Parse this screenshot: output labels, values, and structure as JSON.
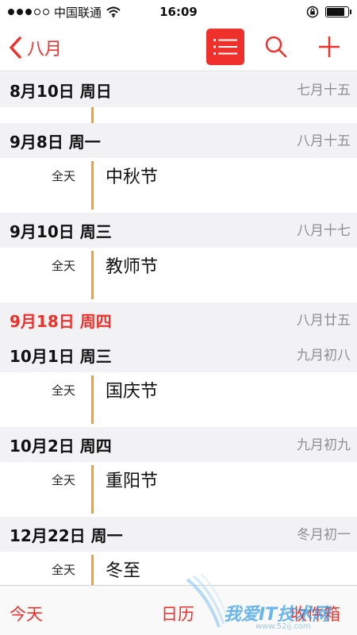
{
  "status_bar": {
    "carrier": "中国联通",
    "time": "16:09",
    "signal_bars_filled": 3,
    "signal_bars_total": 5,
    "battery_level": 0.85
  },
  "nav": {
    "back_label": "八月",
    "icons": [
      "chevron-left-icon",
      "list-icon",
      "search-icon",
      "plus-icon"
    ]
  },
  "days": [
    {
      "date": "8月10日  周日",
      "lunar": "七月十五",
      "is_today": false,
      "events": [
        {
          "when": "",
          "title": ""
        }
      ]
    },
    {
      "date": "9月8日  周一",
      "lunar": "八月十五",
      "is_today": false,
      "events": [
        {
          "when": "全天",
          "title": "中秋节"
        }
      ]
    },
    {
      "date": "9月10日  周三",
      "lunar": "八月十七",
      "is_today": false,
      "events": [
        {
          "when": "全天",
          "title": "教师节"
        }
      ]
    },
    {
      "date": "9月18日  周四",
      "lunar": "八月廿五",
      "is_today": true,
      "events": []
    },
    {
      "date": "10月1日  周三",
      "lunar": "九月初八",
      "is_today": false,
      "events": [
        {
          "when": "全天",
          "title": "国庆节"
        }
      ]
    },
    {
      "date": "10月2日  周四",
      "lunar": "九月初九",
      "is_today": false,
      "events": [
        {
          "when": "全天",
          "title": "重阳节"
        }
      ]
    },
    {
      "date": "12月22日  周一",
      "lunar": "冬月初一",
      "is_today": false,
      "events": [
        {
          "when": "全天",
          "title": "冬至"
        }
      ]
    }
  ],
  "tabs": {
    "today": "今天",
    "calendars": "日历",
    "inbox": "收件箱"
  },
  "watermark": {
    "text": "我爱IT技术网",
    "url": "www.52ij.com"
  },
  "colors": {
    "accent": "#f0312b",
    "event_bar": "#f0a030",
    "header_bg": "#f2f2f4",
    "lunar_text": "#8e8e93"
  }
}
